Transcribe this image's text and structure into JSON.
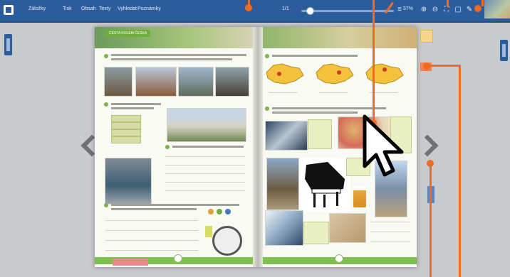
{
  "toolbar": {
    "menu": [
      "Záložky",
      "Tisk",
      "Obsah",
      "Texty",
      "Vyhledat",
      "Poznámky"
    ],
    "page_label": "1/1",
    "zoom_percent": "57%",
    "zoom_level": 0.05
  },
  "book": {
    "left_header_title": "CESTA KOLEM ČESKA"
  },
  "colors": {
    "toolbar": "#2b5d9c",
    "accent_green": "#7fbf4d",
    "annotation": "#f06a24"
  },
  "icons": [
    "menu-icon",
    "zoom-in-icon",
    "zoom-out-icon",
    "fit-icon",
    "fullscreen-icon",
    "pen-icon",
    "help-icon",
    "prev-page-icon",
    "next-page-icon",
    "cursor-icon"
  ]
}
